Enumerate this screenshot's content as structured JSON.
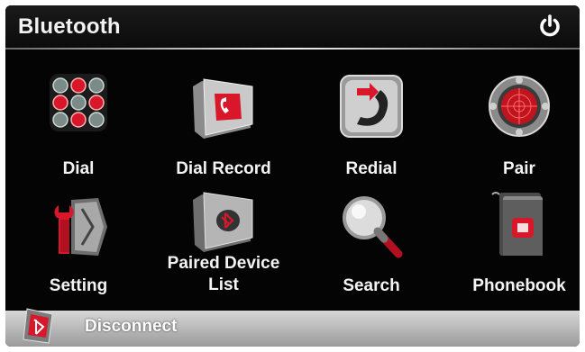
{
  "header": {
    "title": "Bluetooth",
    "power_icon": "power-icon"
  },
  "menu": {
    "dial": "Dial",
    "dial_record": "Dial Record",
    "redial": "Redial",
    "pair": "Pair",
    "setting": "Setting",
    "paired_device_list_line1": "Paired Device",
    "paired_device_list_line2": "List",
    "search": "Search",
    "phonebook": "Phonebook"
  },
  "footer": {
    "disconnect": "Disconnect"
  },
  "colors": {
    "accent": "#d8182a",
    "background": "#040404",
    "footer": "#b8b8b8"
  }
}
